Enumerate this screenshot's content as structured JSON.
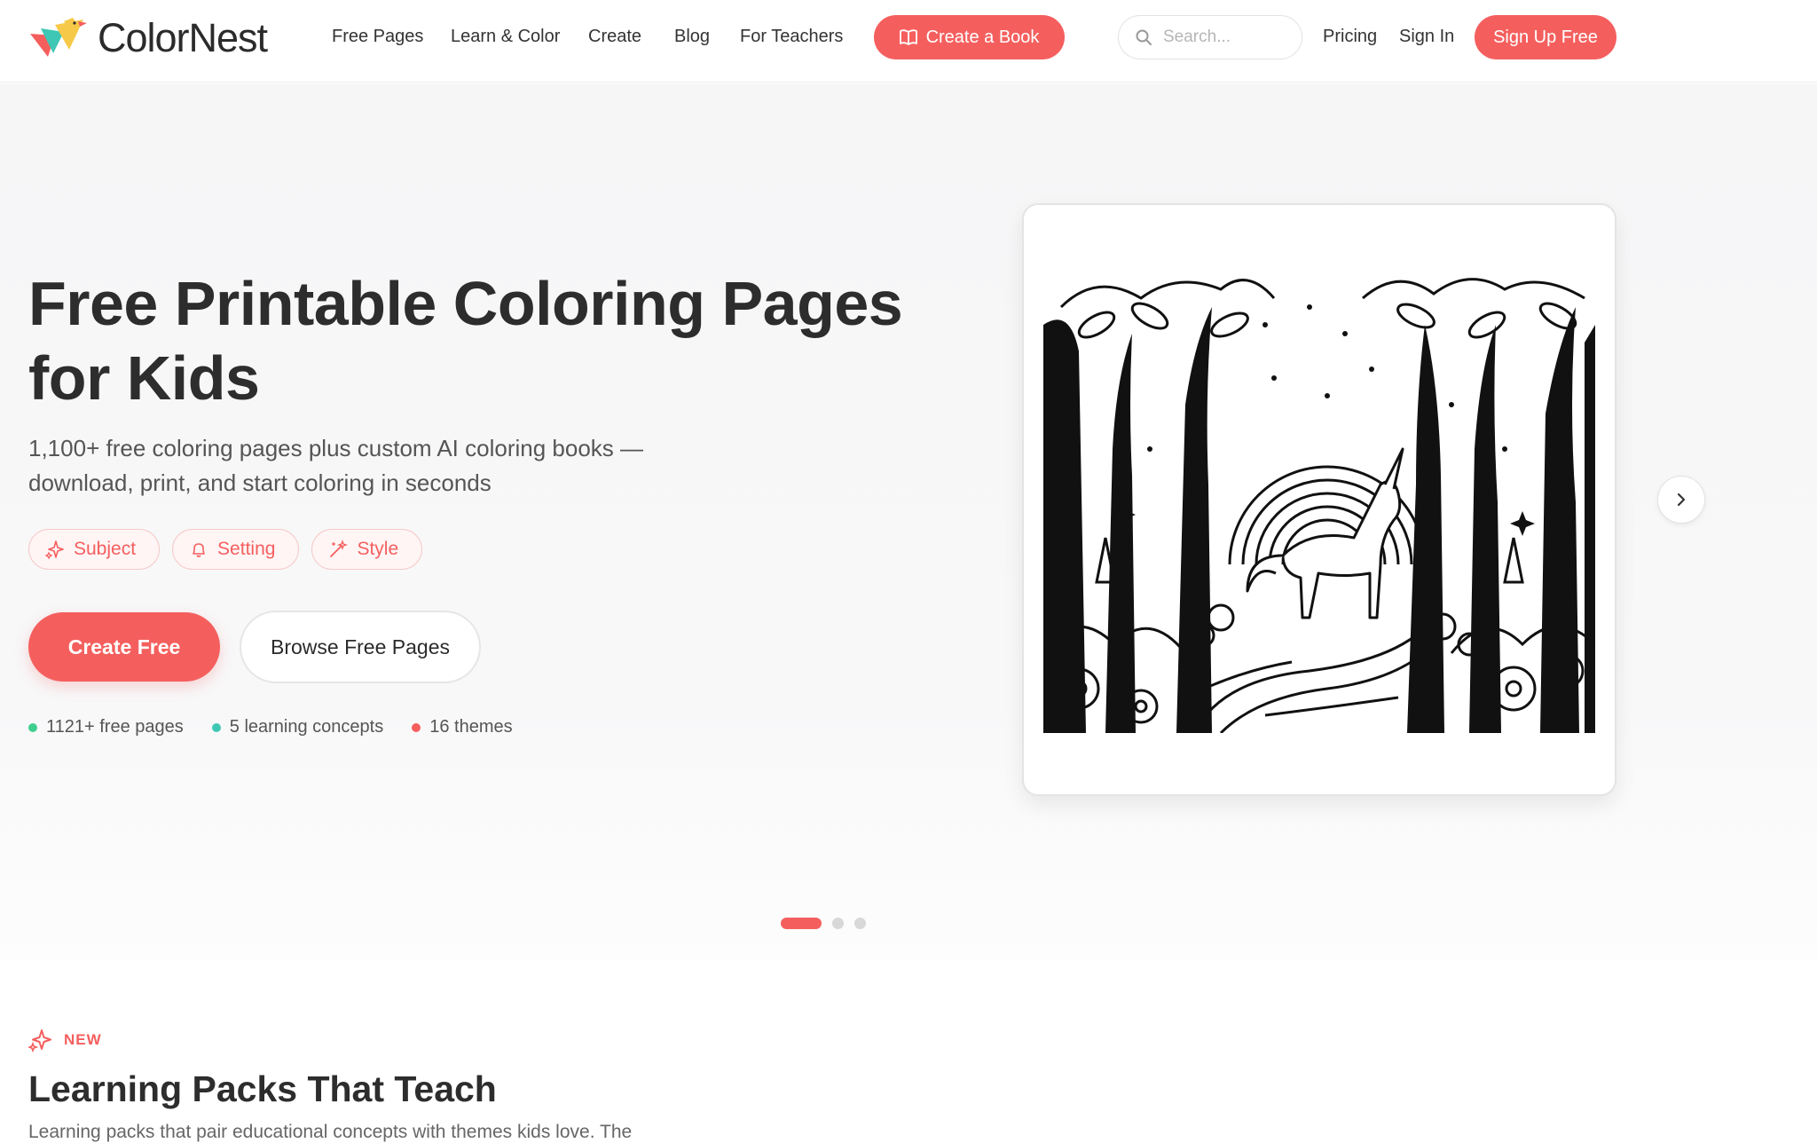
{
  "brand": {
    "name": "ColorNest",
    "primary_color": "#f45f5e",
    "text_color": "#2d2d2d"
  },
  "nav": {
    "links": [
      "Free Pages",
      "Learn & Color",
      "Create",
      "Blog",
      "For Teachers"
    ],
    "create_book_label": "Create a Book",
    "search_placeholder": "Search...",
    "pricing_label": "Pricing",
    "signin_label": "Sign In",
    "signup_label": "Sign Up Free"
  },
  "hero": {
    "title": "Free Printable Coloring Pages for Kids",
    "subtitle": "1,100+ free coloring pages plus custom AI coloring books — download, print, and start coloring in seconds",
    "tags": [
      {
        "label": "Subject",
        "icon": "sparkle-icon"
      },
      {
        "label": "Setting",
        "icon": "bell-icon"
      },
      {
        "label": "Style",
        "icon": "magic-wand-icon"
      }
    ],
    "primary_cta": "Create Free",
    "secondary_cta": "Browse Free Pages",
    "stats": [
      {
        "text": "1121+ free pages",
        "color": "#3ecf8e"
      },
      {
        "text": "5 learning concepts",
        "color": "#3ec7b4"
      },
      {
        "text": "16 themes",
        "color": "#f45f5e"
      }
    ],
    "preview_image": "unicorn-forest-coloring-page",
    "carousel": {
      "slides": 3,
      "active": 0
    }
  },
  "learning_section": {
    "badge": "NEW",
    "title": "Learning Packs That Teach",
    "description": "Learning packs that pair educational concepts with themes kids love. The"
  }
}
